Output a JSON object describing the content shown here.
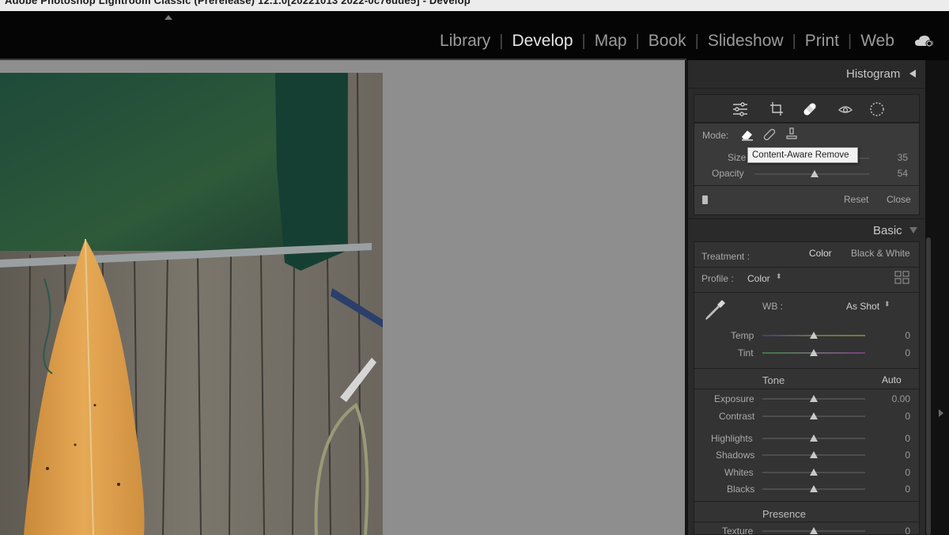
{
  "window": {
    "title": "Adobe Photoshop Lightroom Classic (Prerelease) 12.1.0[20221013 2022-0c76dde5] - Develop"
  },
  "modules": [
    "Library",
    "Develop",
    "Map",
    "Book",
    "Slideshow",
    "Print",
    "Web"
  ],
  "active_module": "Develop",
  "histogram": {
    "label": "Histogram"
  },
  "tool_strip": [
    "edit-sliders-icon",
    "crop-icon",
    "healing-icon",
    "red-eye-icon",
    "masking-icon"
  ],
  "remove_tool": {
    "mode_label": "Mode:",
    "size_label": "Size",
    "size_value": "35",
    "opacity_label": "Opacity",
    "opacity_value": "54",
    "reset": "Reset",
    "close": "Close",
    "tooltip": "Content-Aware Remove"
  },
  "basic": {
    "title": "Basic",
    "treatment_label": "Treatment :",
    "treatment_color": "Color",
    "treatment_bw": "Black & White",
    "profile_label": "Profile :",
    "profile_value": "Color",
    "wb_label": "WB :",
    "wb_value": "As Shot",
    "temp": {
      "label": "Temp",
      "value": "0"
    },
    "tint": {
      "label": "Tint",
      "value": "0"
    },
    "tone_label": "Tone",
    "auto": "Auto",
    "exposure": {
      "label": "Exposure",
      "value": "0.00"
    },
    "contrast": {
      "label": "Contrast",
      "value": "0"
    },
    "highlights": {
      "label": "Highlights",
      "value": "0"
    },
    "shadows": {
      "label": "Shadows",
      "value": "0"
    },
    "whites": {
      "label": "Whites",
      "value": "0"
    },
    "blacks": {
      "label": "Blacks",
      "value": "0"
    },
    "presence_label": "Presence",
    "texture": {
      "label": "Texture",
      "value": "0"
    }
  },
  "colors": {
    "panel": "#333333",
    "canvas": "#8e8e8e",
    "text": "#cfcfcf"
  }
}
